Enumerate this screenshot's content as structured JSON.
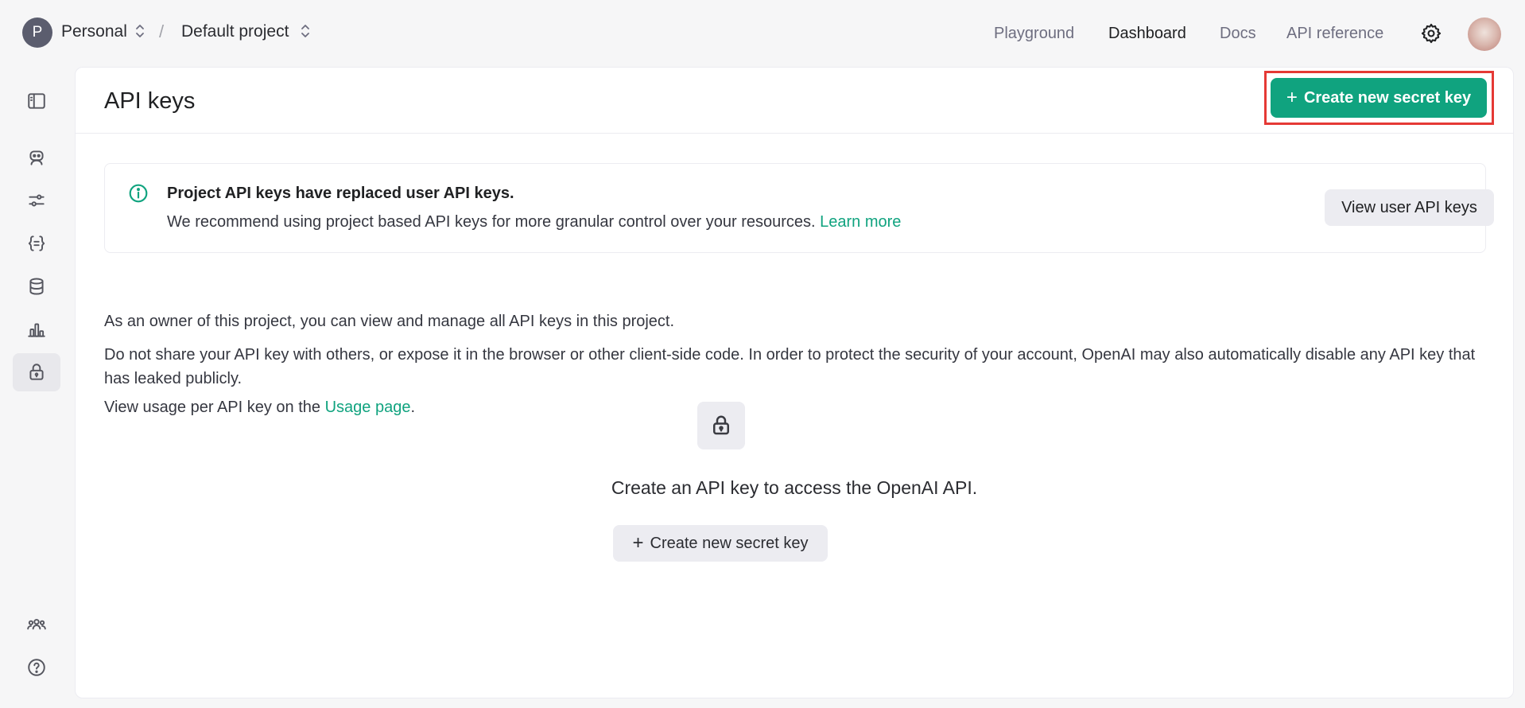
{
  "org": {
    "initial": "P",
    "name": "Personal"
  },
  "project": {
    "name": "Default project"
  },
  "breadcrumb_separator": "/",
  "nav": {
    "playground": "Playground",
    "dashboard": "Dashboard",
    "docs": "Docs",
    "api_reference": "API reference"
  },
  "page": {
    "title": "API keys",
    "create_button": "Create new secret key"
  },
  "notice": {
    "title": "Project API keys have replaced user API keys.",
    "body": "We recommend using project based API keys for more granular control over your resources.",
    "link": "Learn more",
    "button": "View user API keys"
  },
  "paragraphs": {
    "owner": "As an owner of this project, you can view and manage all API keys in this project.",
    "security": "Do not share your API key with others, or expose it in the browser or other client-side code. In order to protect the security of your account, OpenAI may also automatically disable any API key that has leaked publicly.",
    "usage_prefix": "View usage per API key on the",
    "usage_link": "Usage page",
    "usage_suffix": "."
  },
  "empty_state": {
    "title": "Create an API key to access the OpenAI API.",
    "button": "Create new secret key"
  },
  "colors": {
    "accent": "#10a37f",
    "highlight": "#e53935"
  }
}
